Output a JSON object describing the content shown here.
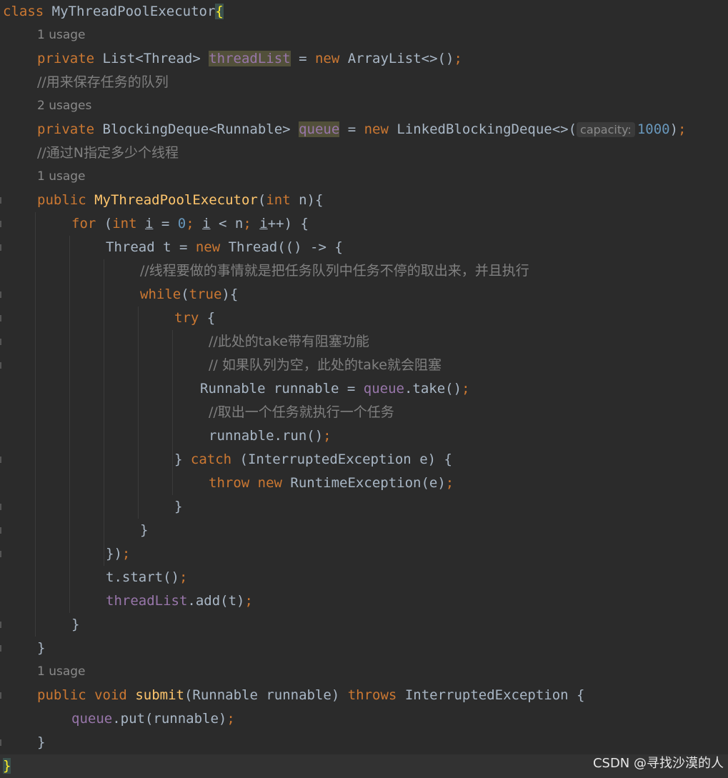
{
  "editor": {
    "lines": [
      {
        "kind": "code",
        "indent": 0,
        "tokens": [
          {
            "t": "class",
            "c": "kw"
          },
          {
            "t": " MyThreadPoolExecutor"
          },
          {
            "t": "{",
            "c": "brace"
          }
        ]
      },
      {
        "kind": "hint",
        "indent": 1,
        "text": "1 usage"
      },
      {
        "kind": "code",
        "indent": 1,
        "tokens": [
          {
            "t": "private",
            "c": "kw"
          },
          {
            "t": " List<Thread> "
          },
          {
            "t": "threadList",
            "c": "field hl"
          },
          {
            "t": " = "
          },
          {
            "t": "new",
            "c": "kw"
          },
          {
            "t": " ArrayList<>()"
          },
          {
            "t": ";",
            "c": "kw"
          }
        ]
      },
      {
        "kind": "code",
        "indent": 1,
        "tokens": [
          {
            "t": "//用来保存任务的队列",
            "c": "cm"
          }
        ]
      },
      {
        "kind": "hint",
        "indent": 1,
        "text": "2 usages"
      },
      {
        "kind": "code",
        "indent": 1,
        "tokens": [
          {
            "t": "private",
            "c": "kw"
          },
          {
            "t": " BlockingDeque<Runnable> "
          },
          {
            "t": "queue",
            "c": "field hl"
          },
          {
            "t": " = "
          },
          {
            "t": "new",
            "c": "kw"
          },
          {
            "t": " LinkedBlockingDeque<>("
          },
          {
            "t": "capacity:",
            "c": "hint"
          },
          {
            "t": "1000",
            "c": "num"
          },
          {
            "t": ")"
          },
          {
            "t": ";",
            "c": "kw"
          }
        ]
      },
      {
        "kind": "code",
        "indent": 1,
        "tokens": [
          {
            "t": "//通过N指定多少个线程",
            "c": "cm"
          }
        ]
      },
      {
        "kind": "hint",
        "indent": 1,
        "text": "1 usage"
      },
      {
        "kind": "code",
        "indent": 1,
        "gutter": true,
        "tokens": [
          {
            "t": "public",
            "c": "kw"
          },
          {
            "t": " "
          },
          {
            "t": "MyThreadPoolExecutor",
            "c": "fn"
          },
          {
            "t": "("
          },
          {
            "t": "int",
            "c": "kw"
          },
          {
            "t": " n){"
          }
        ]
      },
      {
        "kind": "code",
        "indent": 2,
        "gutter": true,
        "tokens": [
          {
            "t": "for",
            "c": "kw"
          },
          {
            "t": " ("
          },
          {
            "t": "int",
            "c": "kw"
          },
          {
            "t": " "
          },
          {
            "t": "i",
            "c": "ul"
          },
          {
            "t": " = "
          },
          {
            "t": "0",
            "c": "num"
          },
          {
            "t": "; ",
            "c": "kw"
          },
          {
            "t": "i",
            "c": "ul"
          },
          {
            "t": " < n"
          },
          {
            "t": "; ",
            "c": "kw"
          },
          {
            "t": "i",
            "c": "ul"
          },
          {
            "t": "++) {"
          }
        ]
      },
      {
        "kind": "code",
        "indent": 3,
        "gutter": true,
        "tokens": [
          {
            "t": "Thread t = "
          },
          {
            "t": "new",
            "c": "kw"
          },
          {
            "t": " Thread(() -> {"
          }
        ]
      },
      {
        "kind": "code",
        "indent": 4,
        "tokens": [
          {
            "t": "//线程要做的事情就是把任务队列中任务不停的取出来，并且执行",
            "c": "cm"
          }
        ]
      },
      {
        "kind": "code",
        "indent": 4,
        "gutter": true,
        "tokens": [
          {
            "t": "while",
            "c": "kw"
          },
          {
            "t": "("
          },
          {
            "t": "true",
            "c": "kw"
          },
          {
            "t": "){"
          }
        ]
      },
      {
        "kind": "code",
        "indent": 5,
        "gutter": true,
        "tokens": [
          {
            "t": "try",
            "c": "kw"
          },
          {
            "t": " {"
          }
        ]
      },
      {
        "kind": "code",
        "indent": 6,
        "gutter": true,
        "tokens": [
          {
            "t": "//此处的take带有阻塞功能",
            "c": "cm"
          }
        ]
      },
      {
        "kind": "code",
        "indent": 6,
        "gutter": true,
        "tokens": [
          {
            "t": "// 如果队列为空，此处的take就会阻塞",
            "c": "cm"
          }
        ]
      },
      {
        "kind": "code",
        "indent": 6,
        "offset": -12,
        "tokens": [
          {
            "t": "Runnable runnable = "
          },
          {
            "t": "queue",
            "c": "field"
          },
          {
            "t": ".take()"
          },
          {
            "t": ";",
            "c": "kw"
          }
        ]
      },
      {
        "kind": "code",
        "indent": 6,
        "tokens": [
          {
            "t": "//取出一个任务就执行一个任务",
            "c": "cm"
          }
        ]
      },
      {
        "kind": "code",
        "indent": 6,
        "tokens": [
          {
            "t": "runnable.run()"
          },
          {
            "t": ";",
            "c": "kw"
          }
        ]
      },
      {
        "kind": "code",
        "indent": 5,
        "gutter": true,
        "tokens": [
          {
            "t": "} "
          },
          {
            "t": "catch",
            "c": "kw"
          },
          {
            "t": " (InterruptedException e) {"
          }
        ]
      },
      {
        "kind": "code",
        "indent": 6,
        "tokens": [
          {
            "t": "throw",
            "c": "kw"
          },
          {
            "t": " "
          },
          {
            "t": "new",
            "c": "kw"
          },
          {
            "t": " RuntimeException(e)"
          },
          {
            "t": ";",
            "c": "kw"
          }
        ]
      },
      {
        "kind": "code",
        "indent": 5,
        "gutter": true,
        "tokens": [
          {
            "t": "}"
          }
        ]
      },
      {
        "kind": "code",
        "indent": 4,
        "gutter": true,
        "tokens": [
          {
            "t": "}"
          }
        ]
      },
      {
        "kind": "code",
        "indent": 3,
        "gutter": true,
        "tokens": [
          {
            "t": "})"
          },
          {
            "t": ";",
            "c": "kw"
          }
        ]
      },
      {
        "kind": "code",
        "indent": 3,
        "tokens": [
          {
            "t": "t.start()"
          },
          {
            "t": ";",
            "c": "kw"
          }
        ]
      },
      {
        "kind": "code",
        "indent": 3,
        "tokens": [
          {
            "t": "threadList",
            "c": "field"
          },
          {
            "t": ".add(t)"
          },
          {
            "t": ";",
            "c": "kw"
          }
        ]
      },
      {
        "kind": "code",
        "indent": 2,
        "gutter": true,
        "tokens": [
          {
            "t": "}"
          }
        ]
      },
      {
        "kind": "code",
        "indent": 1,
        "gutter": true,
        "tokens": [
          {
            "t": "}"
          }
        ]
      },
      {
        "kind": "hint",
        "indent": 1,
        "text": "1 usage"
      },
      {
        "kind": "code",
        "indent": 1,
        "gutter": true,
        "tokens": [
          {
            "t": "public",
            "c": "kw"
          },
          {
            "t": " "
          },
          {
            "t": "void",
            "c": "kw"
          },
          {
            "t": " "
          },
          {
            "t": "submit",
            "c": "fn"
          },
          {
            "t": "(Runnable runnable) "
          },
          {
            "t": "throws",
            "c": "kw"
          },
          {
            "t": " InterruptedException {"
          }
        ]
      },
      {
        "kind": "code",
        "indent": 2,
        "tokens": [
          {
            "t": "queue",
            "c": "field"
          },
          {
            "t": ".put(runnable)"
          },
          {
            "t": ";",
            "c": "kw"
          }
        ]
      },
      {
        "kind": "code",
        "indent": 1,
        "gutter": true,
        "tokens": [
          {
            "t": "}"
          }
        ]
      },
      {
        "kind": "code",
        "indent": 0,
        "current": true,
        "tokens": [
          {
            "t": "}",
            "c": "caret-brace"
          }
        ]
      }
    ]
  },
  "watermark": "CSDN @寻找沙漠的人",
  "colors": {
    "background": "#2b2b2b",
    "text": "#a9b7c6",
    "keyword": "#cc7832",
    "function": "#ffc66d",
    "field": "#9876aa",
    "number": "#6897bb",
    "comment": "#808080"
  }
}
